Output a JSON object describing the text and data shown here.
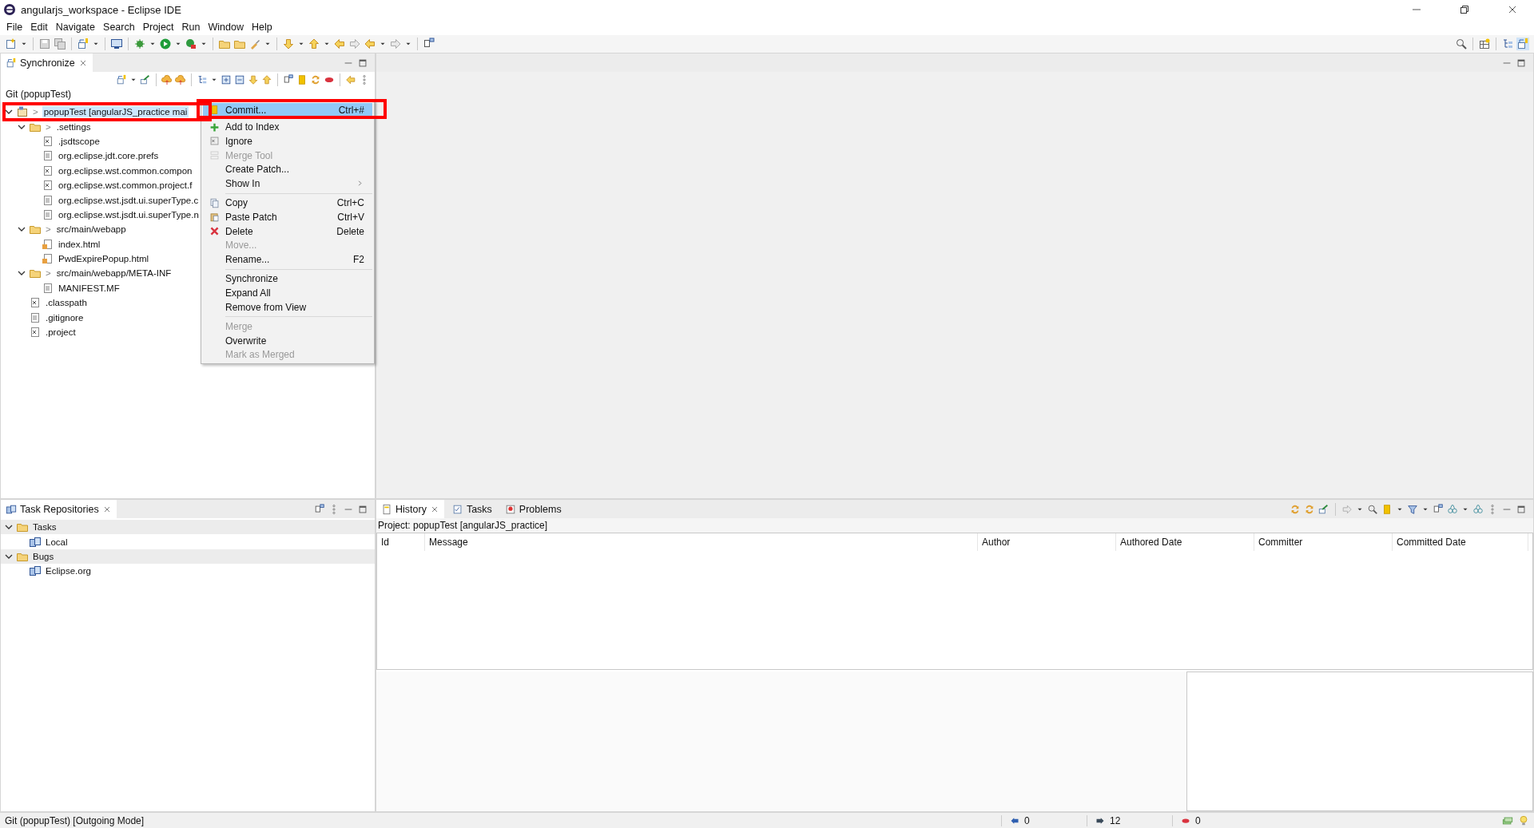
{
  "window": {
    "title": "angularjs_workspace - Eclipse IDE"
  },
  "menu_bar": [
    "File",
    "Edit",
    "Navigate",
    "Search",
    "Project",
    "Run",
    "Window",
    "Help"
  ],
  "synchronize_view": {
    "tab": {
      "label": "Synchronize",
      "selected": true
    },
    "title": "Git (popupTest)",
    "tree": [
      {
        "label": "popupTest [angularJS_practice mai",
        "marker": ">",
        "kind": "project",
        "expanded": true,
        "selected": true,
        "children": [
          {
            "label": ".settings",
            "marker": ">",
            "kind": "folder",
            "expanded": true,
            "selected": false,
            "children": [
              {
                "label": ".jsdtscope",
                "kind": "xml",
                "selected": false
              },
              {
                "label": "org.eclipse.jdt.core.prefs",
                "kind": "text",
                "selected": false
              },
              {
                "label": "org.eclipse.wst.common.compon",
                "kind": "xml",
                "selected": false
              },
              {
                "label": "org.eclipse.wst.common.project.f",
                "kind": "xml",
                "selected": false
              },
              {
                "label": "org.eclipse.wst.jsdt.ui.superType.c",
                "kind": "text",
                "selected": false
              },
              {
                "label": "org.eclipse.wst.jsdt.ui.superType.n",
                "kind": "text",
                "selected": false
              }
            ]
          },
          {
            "label": "src/main/webapp",
            "marker": ">",
            "kind": "folder",
            "expanded": true,
            "selected": false,
            "children": [
              {
                "label": "index.html",
                "kind": "html",
                "selected": false
              },
              {
                "label": "PwdExpirePopup.html",
                "kind": "html",
                "selected": false
              }
            ]
          },
          {
            "label": "src/main/webapp/META-INF",
            "marker": ">",
            "kind": "folder",
            "expanded": true,
            "selected": false,
            "children": [
              {
                "label": "MANIFEST.MF",
                "kind": "text",
                "selected": false
              }
            ]
          },
          {
            "label": ".classpath",
            "kind": "xml",
            "selected": false
          },
          {
            "label": ".gitignore",
            "kind": "text",
            "selected": false
          },
          {
            "label": ".project",
            "kind": "xml",
            "selected": false
          }
        ]
      }
    ]
  },
  "context_menu": {
    "items": [
      {
        "kind": "item",
        "label": "Commit...",
        "shortcut": "Ctrl+#",
        "disabled": false,
        "selected": true
      },
      {
        "kind": "item",
        "label": "Add to Index",
        "disabled": false,
        "selected": false
      },
      {
        "kind": "item",
        "label": "Ignore",
        "disabled": false,
        "selected": false
      },
      {
        "kind": "item",
        "label": "Merge Tool",
        "disabled": true,
        "selected": false
      },
      {
        "kind": "item",
        "label": "Create Patch...",
        "disabled": false,
        "selected": false
      },
      {
        "kind": "item",
        "label": "Show In",
        "disabled": false,
        "selected": false,
        "submenu": true
      },
      {
        "kind": "separator"
      },
      {
        "kind": "item",
        "label": "Copy",
        "shortcut": "Ctrl+C",
        "disabled": false,
        "selected": false
      },
      {
        "kind": "item",
        "label": "Paste Patch",
        "shortcut": "Ctrl+V",
        "disabled": false,
        "selected": false
      },
      {
        "kind": "item",
        "label": "Delete",
        "shortcut": "Delete",
        "disabled": false,
        "selected": false
      },
      {
        "kind": "item",
        "label": "Move...",
        "disabled": true,
        "selected": false
      },
      {
        "kind": "item",
        "label": "Rename...",
        "shortcut": "F2",
        "disabled": false,
        "selected": false
      },
      {
        "kind": "separator"
      },
      {
        "kind": "item",
        "label": "Synchronize",
        "disabled": false,
        "selected": false
      },
      {
        "kind": "item",
        "label": "Expand All",
        "disabled": false,
        "selected": false
      },
      {
        "kind": "item",
        "label": "Remove from View",
        "disabled": false,
        "selected": false
      },
      {
        "kind": "separator"
      },
      {
        "kind": "item",
        "label": "Merge",
        "disabled": true,
        "selected": false
      },
      {
        "kind": "item",
        "label": "Overwrite",
        "disabled": false,
        "selected": false
      },
      {
        "kind": "item",
        "label": "Mark as Merged",
        "disabled": true,
        "selected": false
      }
    ]
  },
  "task_repositories": {
    "tab": {
      "label": "Task Repositories",
      "selected": true
    },
    "tree": [
      {
        "label": "Tasks",
        "kind": "category",
        "expanded": true,
        "selected": false,
        "children": [
          {
            "label": "Local",
            "kind": "repository",
            "selected": false
          }
        ]
      },
      {
        "label": "Bugs",
        "kind": "category",
        "expanded": true,
        "selected": false,
        "children": [
          {
            "label": "Eclipse.org",
            "kind": "repository",
            "selected": false
          }
        ]
      }
    ]
  },
  "history_view": {
    "tabs": [
      {
        "label": "History",
        "selected": true
      },
      {
        "label": "Tasks",
        "selected": false
      },
      {
        "label": "Problems",
        "selected": false
      }
    ],
    "project": "Project: popupTest [angularJS_practice]",
    "columns": [
      "Id",
      "Message",
      "Author",
      "Authored Date",
      "Committer",
      "Committed Date"
    ]
  },
  "status_bar": {
    "text": "Git (popupTest) [Outgoing Mode]",
    "incoming": "0",
    "outgoing": "12",
    "conflicts": "0"
  }
}
